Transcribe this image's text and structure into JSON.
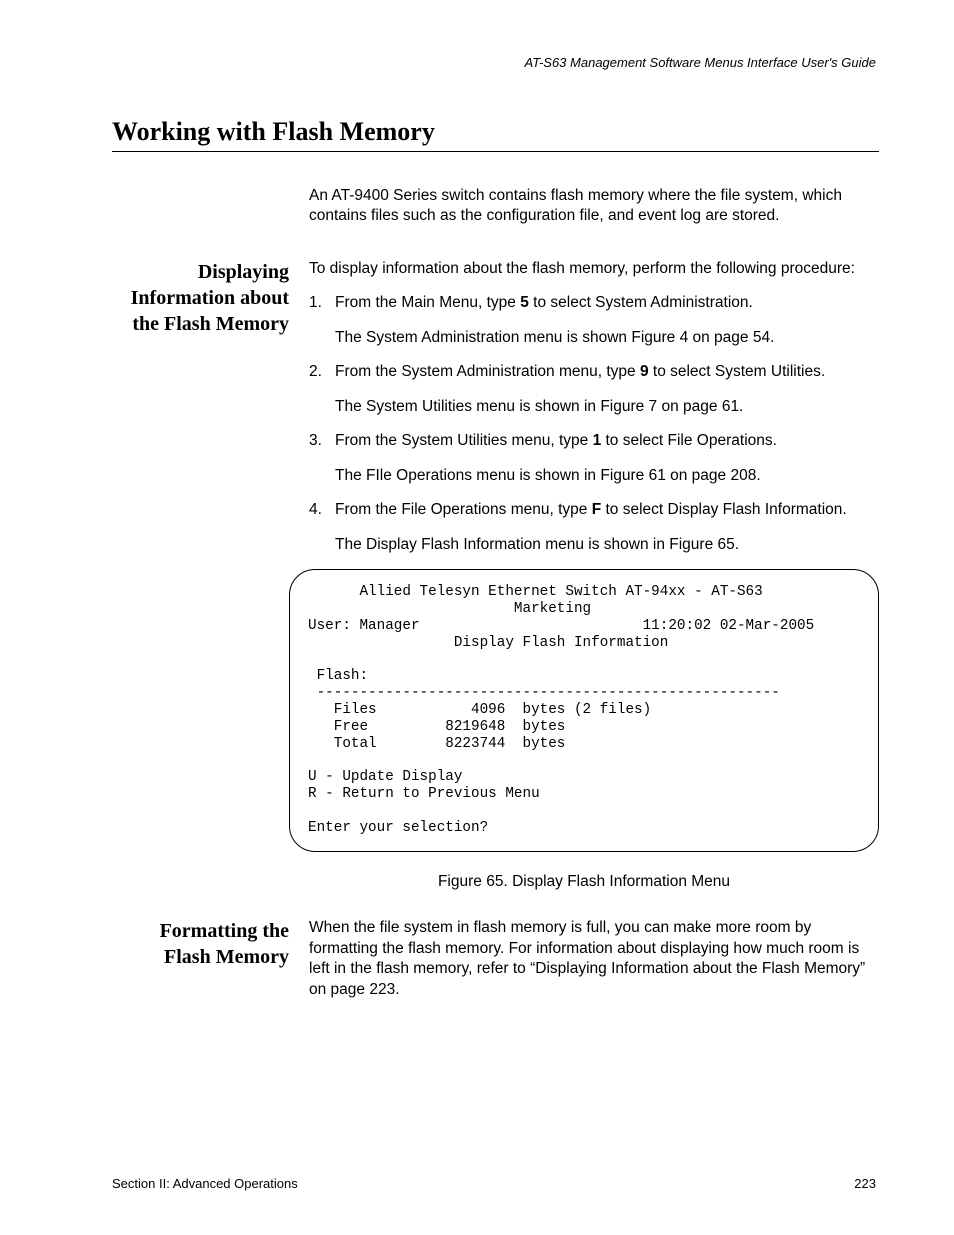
{
  "header": {
    "guide": "AT-S63 Management Software Menus Interface User's Guide"
  },
  "title": "Working with Flash Memory",
  "intro": "An AT-9400 Series switch contains flash memory where the file system, which contains files such as the configuration file, and event log are stored.",
  "section1": {
    "heading": "Displaying Information about the Flash Memory",
    "lead": "To display information about the flash memory, perform the following procedure:",
    "steps": {
      "s1_num": "1.",
      "s1_a": "From the Main Menu, type ",
      "s1_b": "5",
      "s1_c": " to select System Administration.",
      "s1_sub": "The System Administration menu is shown Figure 4 on page 54.",
      "s2_num": "2.",
      "s2_a": "From the System Administration menu, type ",
      "s2_b": "9",
      "s2_c": " to select System Utilities.",
      "s2_sub": "The System Utilities menu is shown in Figure 7 on page 61.",
      "s3_num": "3.",
      "s3_a": "From the System Utilities menu, type ",
      "s3_b": "1",
      "s3_c": " to select File Operations.",
      "s3_sub": "The FIle Operations menu is shown in Figure 61 on page 208.",
      "s4_num": "4.",
      "s4_a": "From the File Operations menu, type ",
      "s4_b": "F",
      "s4_c": " to select Display Flash Information.",
      "s4_sub": "The Display Flash Information menu is shown in Figure 65."
    },
    "terminal": "      Allied Telesyn Ethernet Switch AT-94xx - AT-S63\n                        Marketing\nUser: Manager                          11:20:02 02-Mar-2005\n                 Display Flash Information\n\n Flash:\n ------------------------------------------------------\n   Files           4096  bytes (2 files)\n   Free         8219648  bytes\n   Total        8223744  bytes\n\nU - Update Display\nR - Return to Previous Menu\n\nEnter your selection?",
    "figure_caption": "Figure 65. Display Flash Information Menu"
  },
  "section2": {
    "heading": "Formatting the Flash Memory",
    "body": "When the file system in flash memory is full, you can make more room by formatting the flash memory. For information about displaying how much room is left in the flash memory, refer to “Displaying Information about the Flash Memory” on page 223."
  },
  "footer": {
    "section": "Section II: Advanced Operations",
    "page": "223"
  }
}
